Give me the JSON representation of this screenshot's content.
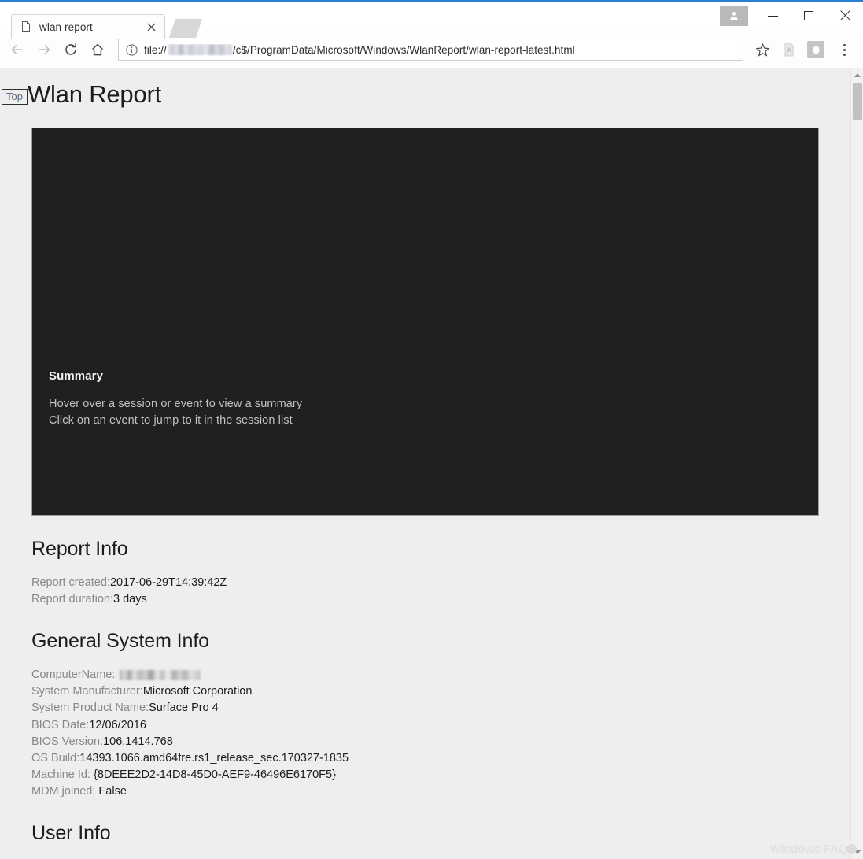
{
  "browser": {
    "tab": {
      "title": "wlan report",
      "favicon_icon": "document-icon",
      "close_icon": "close-icon"
    },
    "newtab_icon": "new-tab-icon",
    "window_controls": {
      "profile_icon": "user-profile-icon",
      "minimize_icon": "minimize-icon",
      "maximize_icon": "maximize-icon",
      "close_icon": "window-close-icon"
    },
    "nav": {
      "back_icon": "arrow-left-icon",
      "forward_icon": "arrow-right-icon",
      "reload_icon": "reload-icon",
      "home_icon": "home-icon"
    },
    "omnibox": {
      "info_icon": "info-circle-icon",
      "scheme": "file://",
      "path": "/c$/ProgramData/Microsoft/Windows/WlanReport/wlan-report-latest.html",
      "redacted_host": "",
      "bookmark_icon": "star-icon"
    },
    "extensions": [
      {
        "name": "pdf-extension-icon"
      },
      {
        "name": "extension-icon"
      }
    ],
    "menu_icon": "three-dots-menu-icon"
  },
  "page": {
    "top_link": "Top",
    "title": "Wlan Report",
    "summary": {
      "heading": "Summary",
      "line1": "Hover over a session or event to view a summary",
      "line2": "Click on an event to jump to it in the session list"
    },
    "report_info": {
      "heading": "Report Info",
      "rows": [
        {
          "key": "Report created:",
          "value": "2017-06-29T14:39:42Z"
        },
        {
          "key": "Report duration:",
          "value": "3 days"
        }
      ]
    },
    "general_system_info": {
      "heading": "General System Info",
      "rows": [
        {
          "key": "ComputerName: ",
          "value": "",
          "redacted": true
        },
        {
          "key": "System Manufacturer:",
          "value": "Microsoft Corporation"
        },
        {
          "key": "System Product Name:",
          "value": "Surface Pro 4"
        },
        {
          "key": "BIOS Date:",
          "value": "12/06/2016"
        },
        {
          "key": "BIOS Version:",
          "value": "106.1414.768"
        },
        {
          "key": "OS Build:",
          "value": "14393.1066.amd64fre.rs1_release_sec.170327-1835"
        },
        {
          "key": "Machine Id: ",
          "value": "{8DEEE2D2-14D8-45D0-AEF9-46496E6170F5}"
        },
        {
          "key": "MDM joined: ",
          "value": "False"
        }
      ]
    },
    "user_info": {
      "heading": "User Info"
    }
  },
  "scrollbar": {
    "up_icon": "scroll-up-arrow-icon",
    "down_icon": "scroll-down-arrow-icon"
  },
  "watermark": {
    "text": "Windows-FAQ"
  },
  "colors": {
    "accent": "#2a7fd4",
    "page_bg": "#eeeeee",
    "summary_bg": "#202020"
  }
}
